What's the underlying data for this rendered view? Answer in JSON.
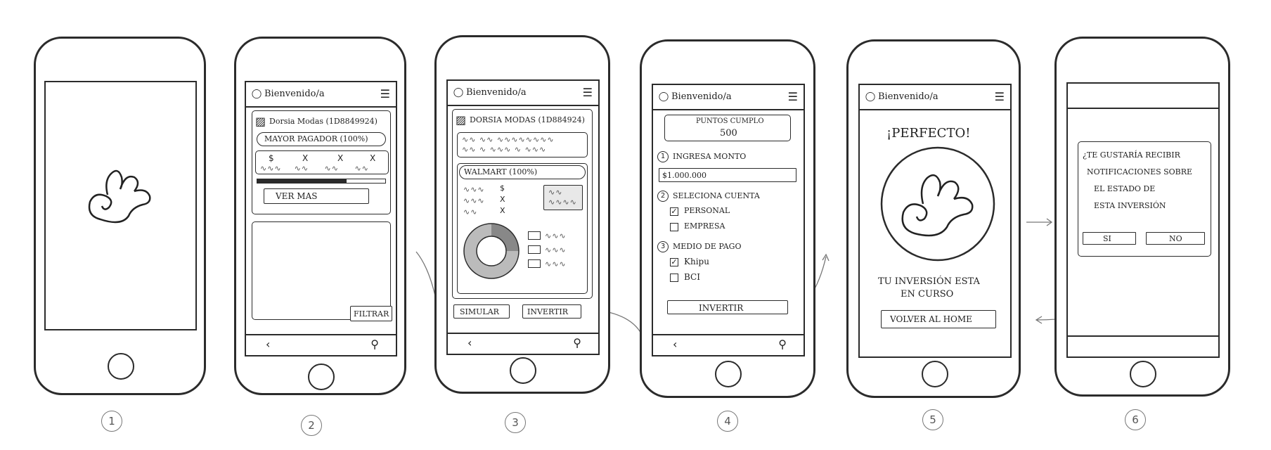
{
  "screens": [
    {
      "number": "1"
    },
    {
      "number": "2",
      "header": {
        "title": "Bienvenido/a"
      },
      "card": {
        "company": "Dorsia Modas (1D8849924)",
        "badge": "MAYOR PAGADOR (100%)",
        "row_labels": [
          "$",
          "X",
          "X",
          "X"
        ],
        "ver_mas": "VER MAS",
        "progress": 0.7
      },
      "filter_label": "FILTRAR"
    },
    {
      "number": "3",
      "header": {
        "title": "Bienvenido/a"
      },
      "card": {
        "company": "DORSIA MODAS (1D884924)",
        "subcompany": "WALMART (100%)",
        "marks": [
          "$",
          "X",
          "X"
        ]
      },
      "buttons": {
        "simulate": "SIMULAR",
        "invest": "INVERTIR"
      }
    },
    {
      "number": "4",
      "header": {
        "title": "Bienvenido/a"
      },
      "points": {
        "label": "PUNTOS CUMPLO",
        "value": "500"
      },
      "steps": [
        {
          "index": "1",
          "label": "INGRESA MONTO"
        },
        {
          "index": "2",
          "label": "SELECIONA CUENTA"
        },
        {
          "index": "3",
          "label": "MEDIO DE PAGO"
        }
      ],
      "amount": "$1.000.000",
      "accounts": [
        {
          "label": "PERSONAL",
          "checked": true
        },
        {
          "label": "EMPRESA",
          "checked": false
        }
      ],
      "payments": [
        {
          "label": "Khipu",
          "checked": true
        },
        {
          "label": "BCI",
          "checked": false
        }
      ],
      "invest_button": "INVERTIR"
    },
    {
      "number": "5",
      "header": {
        "title": "Bienvenido/a"
      },
      "headline": "¡PERFECTO!",
      "message_line1": "TU INVERSIÓN ESTA",
      "message_line2": "EN CURSO",
      "home_button": "VOLVER AL HOME"
    },
    {
      "number": "6",
      "dialog": {
        "line1": "¿TE GUSTARÍA RECIBIR",
        "line2": "NOTIFICACIONES SOBRE",
        "line3": "EL ESTADO DE",
        "line4": "ESTA INVERSIÓN",
        "yes": "SI",
        "no": "NO"
      }
    }
  ]
}
